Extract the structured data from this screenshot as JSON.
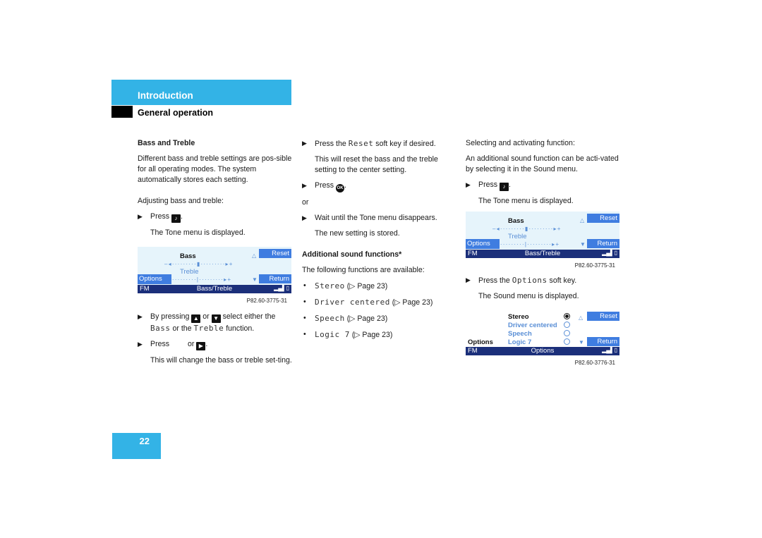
{
  "header": {
    "section": "Introduction",
    "subsection": "General operation"
  },
  "page_number": "22",
  "col1": {
    "heading": "Bass and Treble",
    "intro": "Different bass and treble settings are pos-sible for all operating modes. The system automatically stores each setting.",
    "adjusting": "Adjusting bass and treble:",
    "step1_prefix": "Press",
    "step1_suffix": ".",
    "step1_result": "The Tone menu is displayed.",
    "screen": {
      "row1_label": "Bass",
      "row2_label": "Treble",
      "slider_bass": "– ◂ · · · · · · · · · ▮ · · · · · · · · · ▸ +",
      "slider_treble": "– ◂ · · · · · · · · · | · · · · · · · · · ▸ +",
      "reset": "Reset",
      "return": "Return",
      "options": "Options",
      "status_left": "FM",
      "status_center": "Bass/Treble",
      "signal": "▂▄▌▯"
    },
    "caption": "P82.60-3775-31",
    "step2_a": "By pressing",
    "step2_b": "or",
    "step2_c": "select either the",
    "step2_bass": "Bass",
    "step2_d": "or the",
    "step2_treble": "Treble",
    "step2_e": "function.",
    "step3_a": "Press",
    "step3_b": "or",
    "step3_c": ".",
    "step3_result": "This will change the bass or treble set-ting."
  },
  "col2": {
    "step1_a": "Press the",
    "step1_key": "Reset",
    "step1_b": "soft key if desired.",
    "step1_result": "This will reset the bass and the treble setting to the center setting.",
    "step2_a": "Press",
    "step2_b": ".",
    "or": "or",
    "step3": "Wait until the Tone menu disappears.",
    "step3_result": "The new setting is stored.",
    "heading": "Additional sound functions*",
    "intro": "The following functions are available:",
    "functions": [
      {
        "name": "Stereo",
        "ref": "(▷ Page 23)"
      },
      {
        "name": "Driver centered",
        "ref": "(▷ Page 23)"
      },
      {
        "name": "Speech",
        "ref": "(▷ Page 23)"
      },
      {
        "name": "Logic 7",
        "ref": "(▷ Page 23)"
      }
    ]
  },
  "col3": {
    "heading": "Selecting and activating function:",
    "intro": "An additional sound function can be acti-vated by selecting it in the Sound menu.",
    "step1_a": "Press",
    "step1_b": ".",
    "step1_result": "The Tone menu is displayed.",
    "screen1": {
      "row1_label": "Bass",
      "row2_label": "Treble",
      "slider_bass": "– ◂ · · · · · · · · · ▮ · · · · · · · · · ▸ +",
      "slider_treble": "– ◂ · · · · · · · · · | · · · · · · · · · ▸ +",
      "reset": "Reset",
      "return": "Return",
      "options": "Options",
      "status_left": "FM",
      "status_center": "Bass/Treble",
      "signal": "▂▄▌▯"
    },
    "caption1": "P82.60-3775-31",
    "step2_a": "Press the",
    "step2_key": "Options",
    "step2_b": "soft key.",
    "step2_result": "The Sound menu is displayed.",
    "screen2": {
      "items": [
        "Stereo",
        "Driver centered",
        "Speech",
        "Logic 7"
      ],
      "selected_index": 0,
      "reset": "Reset",
      "return": "Return",
      "options": "Options",
      "status_left": "FM",
      "status_center": "Options",
      "signal": "▂▄▌▯"
    },
    "caption2": "P82.60-3776-31"
  },
  "icons": {
    "sound_key": "♪",
    "up": "▲",
    "down": "▼",
    "right": "▶",
    "ok": "OK",
    "arrow": "▶",
    "bullet": "•",
    "tri_up": "△",
    "tri_down": "▼"
  }
}
